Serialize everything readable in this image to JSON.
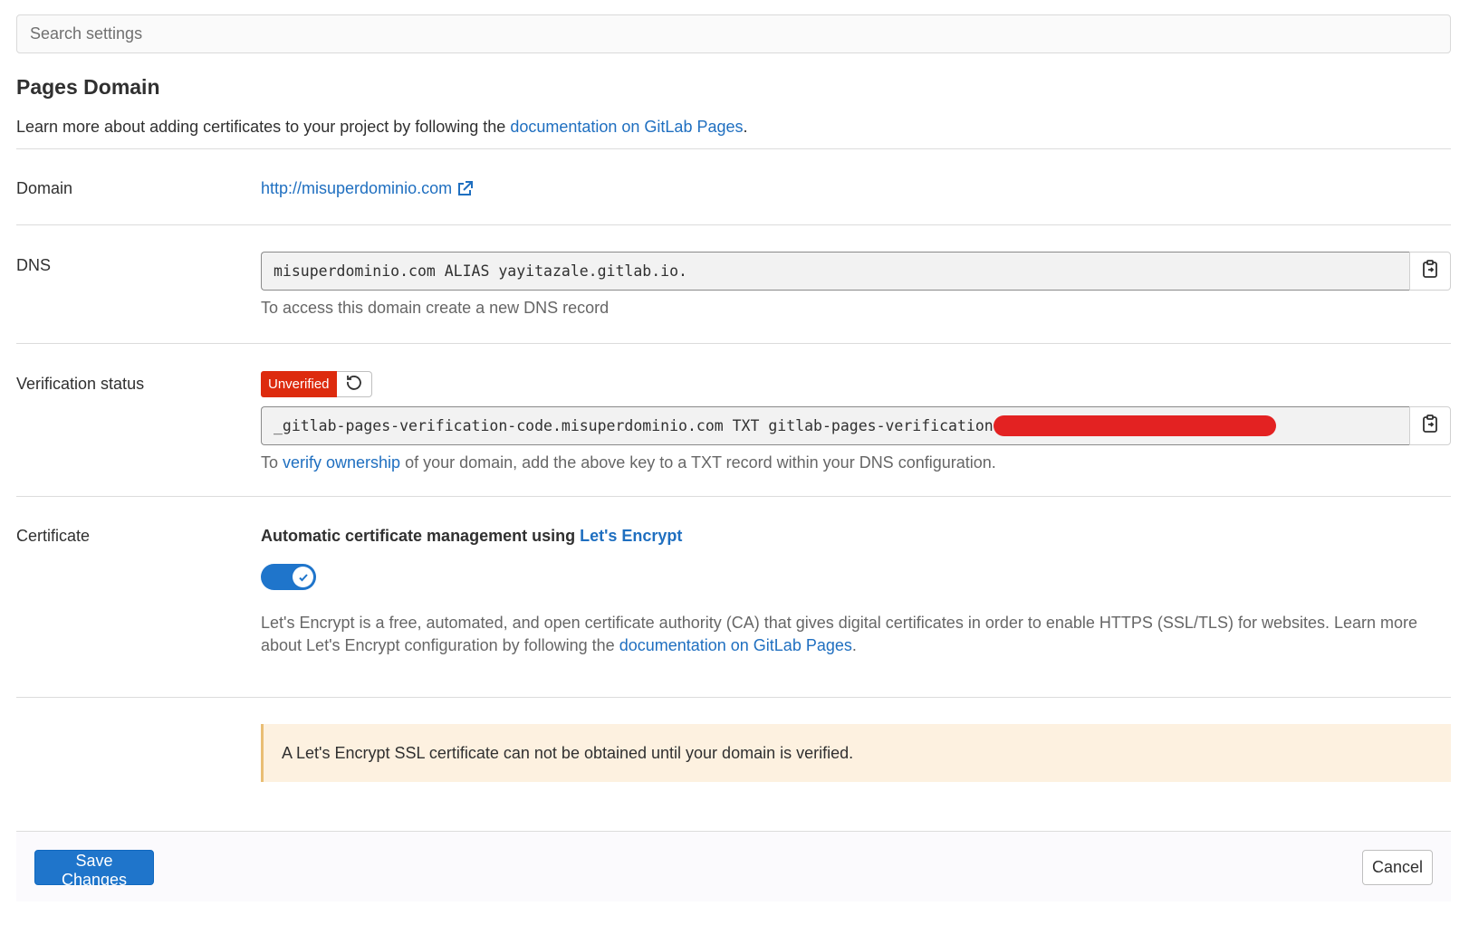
{
  "search": {
    "placeholder": "Search settings"
  },
  "page": {
    "title": "Pages Domain",
    "intro_text": "Learn more about adding certificates to your project by following the ",
    "intro_link": "documentation on GitLab Pages",
    "intro_suffix": "."
  },
  "domain": {
    "label": "Domain",
    "url": "http://misuperdominio.com",
    "icon": "external-link-icon"
  },
  "dns": {
    "label": "DNS",
    "value": "misuperdominio.com ALIAS yayitazale.gitlab.io.",
    "help": "To access this domain create a new DNS record",
    "copy_icon": "clipboard-icon"
  },
  "verification": {
    "label": "Verification status",
    "badge": "Unverified",
    "badge_color": "#dd2b0e",
    "retry_icon": "retry-icon",
    "value": "_gitlab-pages-verification-code.misuperdominio.com TXT gitlab-pages-verification-code=",
    "help_prefix": "To ",
    "help_link": "verify ownership",
    "help_suffix": " of your domain, add the above key to a TXT record within your DNS configuration."
  },
  "certificate": {
    "label": "Certificate",
    "title_prefix": "Automatic certificate management using ",
    "title_link": "Let's Encrypt",
    "toggle_on": true,
    "desc_text": "Let's Encrypt is a free, automated, and open certificate authority (CA) that gives digital certificates in order to enable HTTPS (SSL/TLS) for websites. Learn more about Let's Encrypt configuration by following the ",
    "desc_link": "documentation on GitLab Pages",
    "desc_suffix": "."
  },
  "alert": {
    "text": "A Let's Encrypt SSL certificate can not be obtained until your domain is verified."
  },
  "footer": {
    "save_label": "Save Changes",
    "cancel_label": "Cancel"
  },
  "colors": {
    "link": "#1f6fc0",
    "primary": "#1f75cb",
    "alert_bg": "#fdf1e0"
  }
}
